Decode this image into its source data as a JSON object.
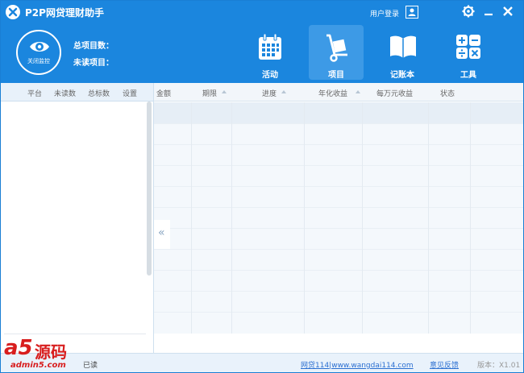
{
  "window": {
    "title": "P2P网贷理财助手"
  },
  "titlebar": {
    "login_label": "用户登录"
  },
  "header": {
    "monitor_label": "关闭监控",
    "total_projects_label": "总项目数：",
    "unread_projects_label": "未读项目："
  },
  "nav": {
    "tabs": [
      {
        "label": "活动",
        "icon": "calendar-icon",
        "active": false
      },
      {
        "label": "项目",
        "icon": "hand-truck-icon",
        "active": true
      },
      {
        "label": "记账本",
        "icon": "book-icon",
        "active": false
      },
      {
        "label": "工具",
        "icon": "calculator-icon",
        "active": false
      }
    ]
  },
  "left_table": {
    "columns": [
      "平台",
      "未读数",
      "总标数",
      "设置"
    ]
  },
  "grid": {
    "columns": [
      "金额",
      "期限",
      "进度",
      "年化收益",
      "每万元收益",
      "状态"
    ]
  },
  "statusbar": {
    "read_label": "已读",
    "site_link": "网贷114|www.wangdai114.com",
    "feedback": "意见反馈",
    "version": "版本：X1.01"
  },
  "watermark": {
    "brand": "a5",
    "brand_cn": "源码",
    "url": "admin5.com"
  },
  "colors": {
    "accent": "#1b86de",
    "active_tab": "#3d9ae6",
    "link": "#2b6fd1",
    "watermark": "#d81e1e"
  }
}
